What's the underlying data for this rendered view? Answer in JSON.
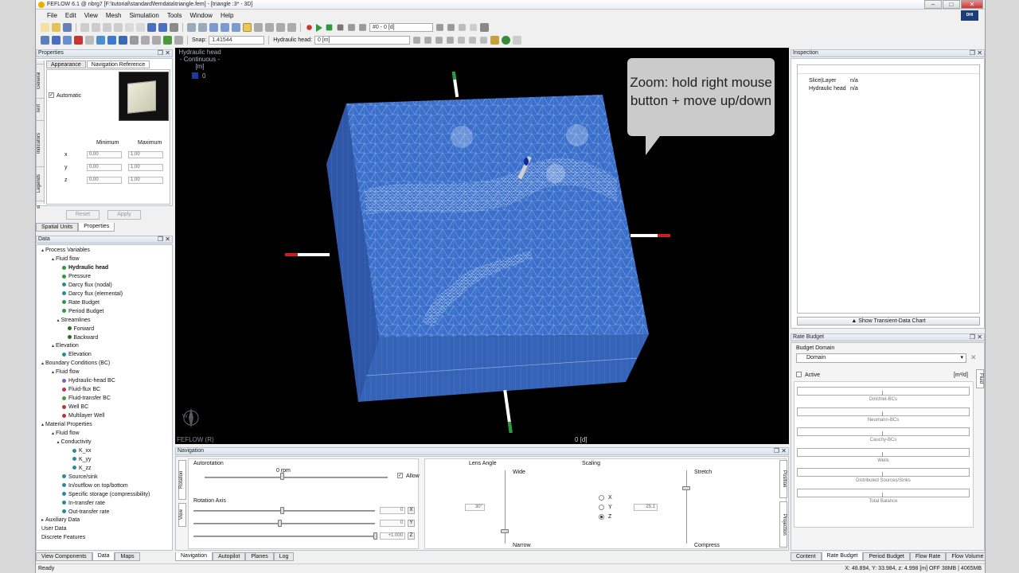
{
  "window": {
    "title": "FEFLOW 6.1 @ nbrg7 [F:\\tutorial\\standard\\femdata\\triangle.fem] - [triangle :3* - 3D]",
    "logo_text": "DHI"
  },
  "menu": [
    "File",
    "Edit",
    "View",
    "Mesh",
    "Simulation",
    "Tools",
    "Window",
    "Help"
  ],
  "toolbar": {
    "timestep_combo": "#0 - 0 [d]",
    "snap_label": "Snap:",
    "snap_value": "1.41544",
    "hydraulic_label": "Hydraulic head:",
    "hydraulic_value": "0 [m]"
  },
  "properties": {
    "title": "Properties",
    "tabs": [
      "Appearance",
      "Navigation Reference"
    ],
    "side_tabs": [
      "General",
      "Text",
      "Indicators",
      "Legends",
      "ugo"
    ],
    "automatic_label": "Automatic",
    "min_label": "Minimum",
    "max_label": "Maximum",
    "rows": [
      {
        "axis": "x",
        "min": "0,00",
        "max": "1,00"
      },
      {
        "axis": "y",
        "min": "0,00",
        "max": "1,00"
      },
      {
        "axis": "z",
        "min": "0,00",
        "max": "1,00"
      }
    ],
    "reset": "Reset",
    "apply": "Apply",
    "bottom_tabs": [
      "Spatial Units",
      "Properties"
    ]
  },
  "data_panel": {
    "title": "Data",
    "items": [
      {
        "label": "Process Variables",
        "lvl": 0,
        "arrow": "▴",
        "icon": ""
      },
      {
        "label": "Fluid flow",
        "lvl": 1,
        "arrow": "▴",
        "icon": ""
      },
      {
        "label": "Hydraulic head",
        "lvl": 2,
        "arrow": "",
        "icon": "#2e9b3e",
        "bold": true
      },
      {
        "label": "Pressure",
        "lvl": 2,
        "arrow": "",
        "icon": "#2e9b3e"
      },
      {
        "label": "Darcy flux (nodal)",
        "lvl": 2,
        "arrow": "",
        "icon": "#2a8a9a"
      },
      {
        "label": "Darcy flux (elemental)",
        "lvl": 2,
        "arrow": "",
        "icon": "#2a8a9a"
      },
      {
        "label": "Rate Budget",
        "lvl": 2,
        "arrow": "",
        "icon": "#2e9b3e"
      },
      {
        "label": "Period Budget",
        "lvl": 2,
        "arrow": "",
        "icon": "#2e9b3e"
      },
      {
        "label": "Streamlines",
        "lvl": 1.5,
        "arrow": "▴",
        "icon": ""
      },
      {
        "label": "Forward",
        "lvl": 2.5,
        "arrow": "",
        "icon": "#2e6b2e"
      },
      {
        "label": "Backward",
        "lvl": 2.5,
        "arrow": "",
        "icon": "#2e6b2e"
      },
      {
        "label": "Elevation",
        "lvl": 1,
        "arrow": "▴",
        "icon": ""
      },
      {
        "label": "Elevation",
        "lvl": 2,
        "arrow": "",
        "icon": "#2a8a9a"
      },
      {
        "label": "Boundary Conditions (BC)",
        "lvl": 0,
        "arrow": "▴",
        "icon": ""
      },
      {
        "label": "Fluid flow",
        "lvl": 1,
        "arrow": "▴",
        "icon": ""
      },
      {
        "label": "Hydraulic-head BC",
        "lvl": 2,
        "arrow": "",
        "icon": "#8a5bb5"
      },
      {
        "label": "Fluid-flux BC",
        "lvl": 2,
        "arrow": "",
        "icon": "#c8333b"
      },
      {
        "label": "Fluid-transfer BC",
        "lvl": 2,
        "arrow": "",
        "icon": "#4a9c3a"
      },
      {
        "label": "Well BC",
        "lvl": 2,
        "arrow": "",
        "icon": "#b8333b"
      },
      {
        "label": "Multilayer Well",
        "lvl": 2,
        "arrow": "",
        "icon": "#b8333b"
      },
      {
        "label": "Material Properties",
        "lvl": 0,
        "arrow": "▴",
        "icon": ""
      },
      {
        "label": "Fluid flow",
        "lvl": 1,
        "arrow": "▴",
        "icon": ""
      },
      {
        "label": "Conductivity",
        "lvl": 1.5,
        "arrow": "▴",
        "icon": ""
      },
      {
        "label": "K_xx",
        "lvl": 3,
        "arrow": "",
        "icon": "#2a8a9a"
      },
      {
        "label": "K_yy",
        "lvl": 3,
        "arrow": "",
        "icon": "#2a8a9a"
      },
      {
        "label": "K_zz",
        "lvl": 3,
        "arrow": "",
        "icon": "#2a8a9a"
      },
      {
        "label": "Source/sink",
        "lvl": 2,
        "arrow": "",
        "icon": "#2a8a9a"
      },
      {
        "label": "In/outflow on top/bottom",
        "lvl": 2,
        "arrow": "",
        "icon": "#2a8a9a"
      },
      {
        "label": "Specific storage (compressibility)",
        "lvl": 2,
        "arrow": "",
        "icon": "#2a8a9a"
      },
      {
        "label": "In-transfer rate",
        "lvl": 2,
        "arrow": "",
        "icon": "#2a8a9a"
      },
      {
        "label": "Out-transfer rate",
        "lvl": 2,
        "arrow": "",
        "icon": "#2a8a9a"
      },
      {
        "label": "Auxiliary Data",
        "lvl": 0,
        "arrow": "▸",
        "icon": ""
      },
      {
        "label": "User Data",
        "lvl": 0,
        "arrow": "",
        "icon": ""
      },
      {
        "label": "Discrete Features",
        "lvl": 0,
        "arrow": "",
        "icon": ""
      }
    ],
    "bottom_tabs": [
      "View Components",
      "Data",
      "Maps"
    ]
  },
  "viewport": {
    "legend_title": "Hydraulic head",
    "legend_sub": "- Continuous -",
    "legend_unit": "[m]",
    "legend_value": "0",
    "legend_color": "#1a3aa0",
    "time_label": "0 [d]",
    "watermark": "FEFLOW (R)",
    "compass": "W    E",
    "tip": "Zoom: hold right mouse button + move up/down"
  },
  "inspection": {
    "title": "Inspection",
    "rows": [
      {
        "key": "Slice|Layer",
        "val": "n/a"
      },
      {
        "key": "Hydraulic head",
        "val": "n/a"
      }
    ],
    "chart_button": "Show Transient-Data Chart"
  },
  "rate_budget": {
    "title": "Rate Budget",
    "domain_label": "Budget Domain",
    "domain_value": "Domain",
    "active_label": "Active",
    "unit": "[m³/d]",
    "side_tab": "Fluid",
    "fields": [
      "Dirichlet-BCs",
      "Neumann-BCs",
      "Cauchy-BCs",
      "Wells",
      "Distributed Sources/Sinks",
      "Total Balance"
    ],
    "bottom_tabs": [
      "Content",
      "Rate Budget",
      "Period Budget",
      "Flow Rate",
      "Flow Volume"
    ]
  },
  "navigation": {
    "title": "Navigation",
    "side_tabs": [
      "Rotation",
      "View"
    ],
    "autorotation_label": "Autorotation",
    "rpm": "0 rpm",
    "allow_label": "Allow",
    "rotation_axis_label": "Rotation Axis",
    "axis_values": [
      {
        "v": "0",
        "btn": "X"
      },
      {
        "v": "0",
        "btn": "Y"
      },
      {
        "v": "+1.000",
        "btn": "Z"
      }
    ],
    "lens_label": "Lens Angle",
    "lens_wide": "Wide",
    "lens_narrow": "Narrow",
    "lens_value": "30°",
    "scaling_label": "Scaling",
    "scaling_axes": [
      "X",
      "Y",
      "Z"
    ],
    "scaling_selected": "Z",
    "scaling_value": "25.1",
    "stretch": "Stretch",
    "compress": "Compress",
    "right_tabs": [
      "Position",
      "Projection"
    ],
    "bottom_tabs": [
      "Navigation",
      "Autopilot",
      "Planes",
      "Log"
    ]
  },
  "status": {
    "left": "Ready",
    "coords": "X:  48.894, Y:  33.984, z:   4.998 [m]  OFF  38MB | 4065MB"
  }
}
